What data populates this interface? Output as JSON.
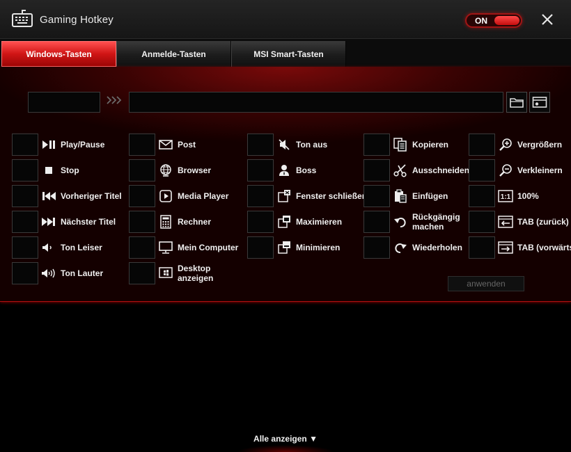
{
  "window": {
    "title": "Gaming Hotkey",
    "toggle_label": "ON"
  },
  "tabs": [
    {
      "label": "Windows-Tasten",
      "active": true
    },
    {
      "label": "Anmelde-Tasten",
      "active": false
    },
    {
      "label": "MSI Smart-Tasten",
      "active": false
    }
  ],
  "hotkeys": {
    "col1": [
      {
        "label": "Play/Pause",
        "icon": "play-pause-icon"
      },
      {
        "label": "Stop",
        "icon": "stop-icon"
      },
      {
        "label": "Vorheriger Titel",
        "icon": "previous-track-icon"
      },
      {
        "label": "Nächster Titel",
        "icon": "next-track-icon"
      },
      {
        "label": "Ton Leiser",
        "icon": "volume-down-icon"
      },
      {
        "label": "Ton Lauter",
        "icon": "volume-up-icon"
      }
    ],
    "col2": [
      {
        "label": "Post",
        "icon": "mail-icon"
      },
      {
        "label": "Browser",
        "icon": "globe-icon"
      },
      {
        "label": "Media Player",
        "icon": "media-player-icon"
      },
      {
        "label": "Rechner",
        "icon": "calculator-icon"
      },
      {
        "label": "Mein Computer",
        "icon": "monitor-icon"
      },
      {
        "label": "Desktop anzeigen",
        "icon": "show-desktop-icon"
      }
    ],
    "col3": [
      {
        "label": "Ton aus",
        "icon": "mute-icon"
      },
      {
        "label": "Boss",
        "icon": "boss-icon"
      },
      {
        "label": "Fenster schließen",
        "icon": "close-window-icon"
      },
      {
        "label": "Maximieren",
        "icon": "maximize-icon"
      },
      {
        "label": "Minimieren",
        "icon": "minimize-icon"
      }
    ],
    "col4": [
      {
        "label": "Kopieren",
        "icon": "copy-icon"
      },
      {
        "label": "Ausschneiden",
        "icon": "scissors-icon"
      },
      {
        "label": "Einfügen",
        "icon": "paste-icon"
      },
      {
        "label": "Rückgängig machen",
        "icon": "undo-icon"
      },
      {
        "label": "Wiederholen",
        "icon": "redo-icon"
      }
    ],
    "col5": [
      {
        "label": "Vergrößern",
        "icon": "zoom-in-icon"
      },
      {
        "label": "Verkleinern",
        "icon": "zoom-out-icon"
      },
      {
        "label": "100%",
        "icon": "actual-size-icon",
        "icon_text": "1:1"
      },
      {
        "label": "TAB (zurück)",
        "icon": "tab-back-icon"
      },
      {
        "label": "TAB (vorwärts)",
        "icon": "tab-forward-icon"
      }
    ]
  },
  "apply_label": "anwenden",
  "show_all_label": "Alle anzeigen ▼",
  "colors": {
    "accent": "#d01515",
    "background": "#000000"
  }
}
